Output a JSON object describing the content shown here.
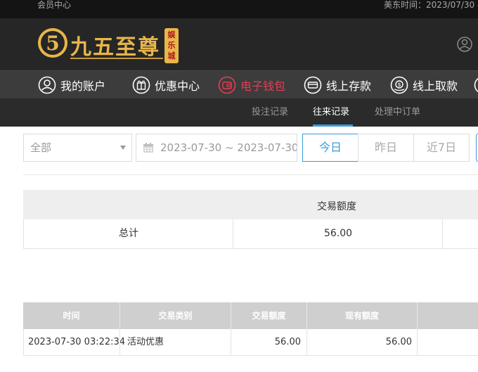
{
  "topbar": {
    "left": "会员中心",
    "right": "美东时间：2023/07/30 -"
  },
  "logo": {
    "number": "5",
    "name": "九五至尊",
    "badge": "娱乐城"
  },
  "nav": [
    {
      "label": "我的账户",
      "icon": "user-circle-icon",
      "active": false
    },
    {
      "label": "优惠中心",
      "icon": "gift-icon",
      "active": false
    },
    {
      "label": "电子钱包",
      "icon": "wallet-icon",
      "active": true
    },
    {
      "label": "线上存款",
      "icon": "deposit-icon",
      "active": false
    },
    {
      "label": "线上取款",
      "icon": "withdraw-icon",
      "active": false
    }
  ],
  "subnav": [
    {
      "label": "投注记录",
      "active": false
    },
    {
      "label": "往来记录",
      "active": true
    },
    {
      "label": "处理中订单",
      "active": false
    }
  ],
  "filters": {
    "type_select": "全部",
    "date_range": "2023-07-30 ~ 2023-07-30",
    "quick": [
      "今日",
      "昨日",
      "近7日"
    ],
    "active_quick": "今日"
  },
  "summary": {
    "header": "交易额度",
    "row_label": "总计",
    "row_value": "56.00"
  },
  "records": {
    "columns": [
      "时间",
      "交易类别",
      "交易额度",
      "现有额度"
    ],
    "rows": [
      {
        "time": "2023-07-30 03:22:34",
        "type": "活动优惠",
        "amount": "56.00",
        "balance": "56.00"
      }
    ]
  },
  "colors": {
    "accent": "#3a9ad9",
    "active_nav": "#e63c55",
    "gold": "#e8b64a"
  }
}
